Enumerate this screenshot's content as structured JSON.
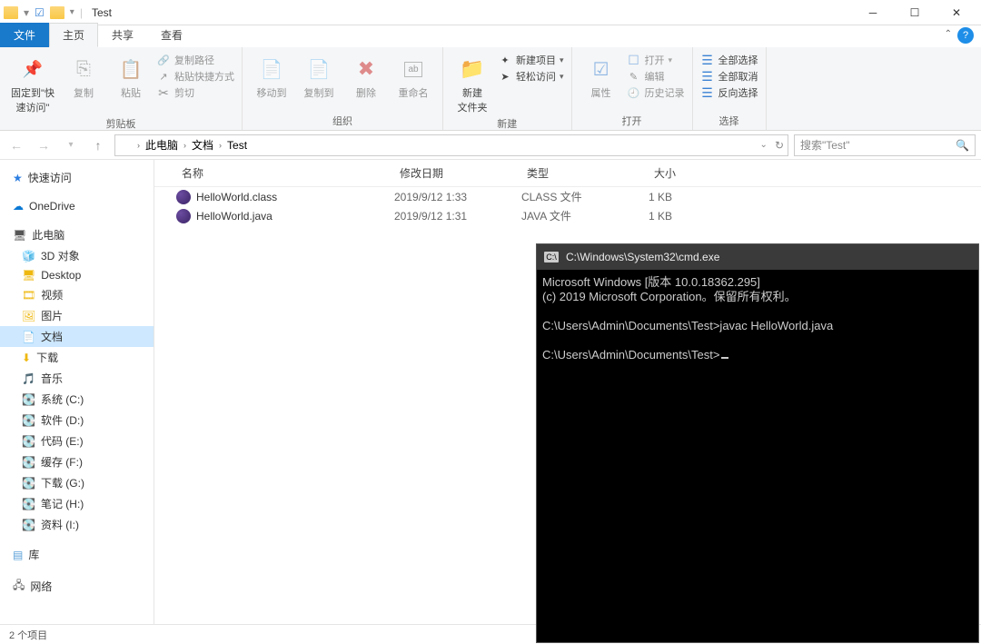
{
  "titlebar": {
    "title": "Test"
  },
  "tabs": {
    "file": "文件",
    "home": "主页",
    "share": "共享",
    "view": "查看"
  },
  "ribbon": {
    "pin": "固定到\"快\n速访问\"",
    "copy": "复制",
    "paste": "粘贴",
    "copypath": "复制路径",
    "pasteshortcut": "粘贴快捷方式",
    "cut": "剪切",
    "clip_label": "剪贴板",
    "moveto": "移动到",
    "copyto": "复制到",
    "delete": "删除",
    "rename": "重命名",
    "org_label": "组织",
    "newfolder": "新建\n文件夹",
    "newitem": "新建项目",
    "easyaccess": "轻松访问",
    "new_label": "新建",
    "properties": "属性",
    "open": "打开",
    "edit": "编辑",
    "history": "历史记录",
    "open_label": "打开",
    "selectall": "全部选择",
    "selectnone": "全部取消",
    "invert": "反向选择",
    "select_label": "选择"
  },
  "breadcrumb": {
    "seg1": "此电脑",
    "seg2": "文档",
    "seg3": "Test"
  },
  "search": {
    "placeholder": "搜索\"Test\""
  },
  "columns": {
    "name": "名称",
    "date": "修改日期",
    "type": "类型",
    "size": "大小"
  },
  "files": [
    {
      "name": "HelloWorld.class",
      "date": "2019/9/12 1:33",
      "type": "CLASS 文件",
      "size": "1 KB"
    },
    {
      "name": "HelloWorld.java",
      "date": "2019/9/12 1:31",
      "type": "JAVA 文件",
      "size": "1 KB"
    }
  ],
  "nav": {
    "quick": "快速访问",
    "onedrive": "OneDrive",
    "thispc": "此电脑",
    "items": [
      "3D 对象",
      "Desktop",
      "视频",
      "图片",
      "文档",
      "下载",
      "音乐",
      "系统 (C:)",
      "软件 (D:)",
      "代码 (E:)",
      "缓存 (F:)",
      "下载 (G:)",
      "笔记 (H:)",
      "资料 (I:)"
    ],
    "lib": "库",
    "network": "网络"
  },
  "status": {
    "text": "2 个项目"
  },
  "cmd": {
    "title": "C:\\Windows\\System32\\cmd.exe",
    "lines": [
      "Microsoft Windows [版本 10.0.18362.295]",
      "(c) 2019 Microsoft Corporation。保留所有权利。",
      "",
      "C:\\Users\\Admin\\Documents\\Test>javac HelloWorld.java",
      "",
      "C:\\Users\\Admin\\Documents\\Test>"
    ]
  }
}
